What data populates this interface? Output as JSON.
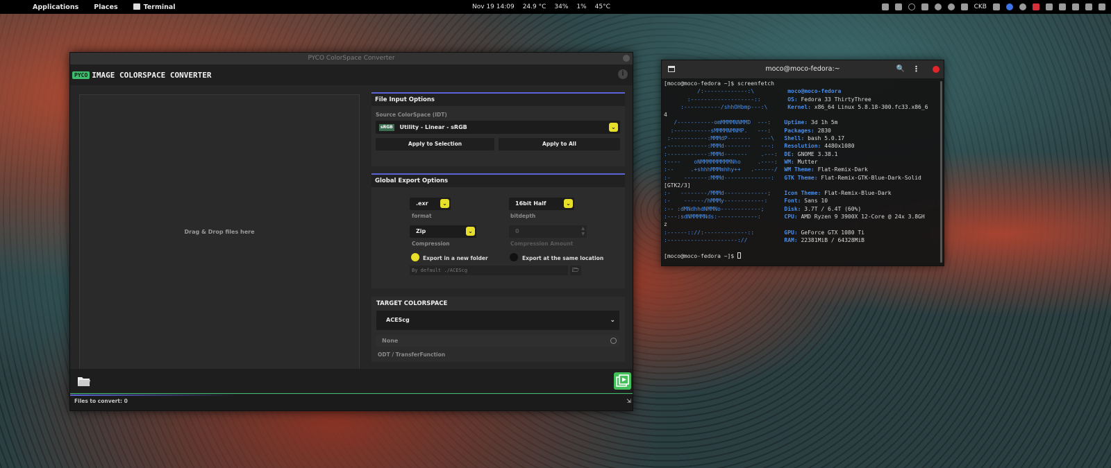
{
  "topbar": {
    "applications": "Applications",
    "places": "Places",
    "terminal": "Terminal",
    "datetime": "Nov 19  14:09",
    "stat1": "24.9 °C",
    "stat2": "34%",
    "stat3": "1%",
    "stat4": "45°C",
    "lang": "CKB"
  },
  "app": {
    "window_title": "PYCO ColorSpace Converter",
    "logo": "PYCO",
    "title": "IMAGE COLORSPACE CONVERTER",
    "info": "i",
    "dropzone_text": "Drag & Drop files here",
    "file_input": {
      "title": "File Input Options",
      "source_label": "Source ColorSpace (IDT)",
      "source_badge": "sRGB",
      "source_value": "Utility - Linear - sRGB",
      "apply_selection": "Apply to Selection",
      "apply_all": "Apply to All"
    },
    "export": {
      "title": "Global Export Options",
      "format_value": ".exr",
      "format_label": "format",
      "bitdepth_value": "16bit Half",
      "bitdepth_label": "bitdepth",
      "compression_value": "Zip",
      "compression_label": "Compression",
      "amount_value": "0",
      "amount_label": "Compression Amount",
      "radio_new_folder": "Export in a new folder",
      "radio_same_location": "Export at the same location",
      "folder_placeholder": "By default ./ACEScg"
    },
    "target": {
      "title": "TARGET COLORSPACE",
      "value": "ACEScg",
      "odt_value": "None",
      "odt_label": "ODT / TransferFunction"
    },
    "status": "Files to convert: 0"
  },
  "terminal": {
    "title": "moco@moco-fedora:~",
    "prompt1": "[moco@moco-fedora ~]$ screenfetch",
    "lines": [
      {
        "art": "          /:-------------:\\          ",
        "key": "",
        "val": "moco@moco-fedora",
        "kc": true
      },
      {
        "art": "       :-------------------::        ",
        "key": "OS: ",
        "val": "Fedora 33 ThirtyThree"
      },
      {
        "art": "     :-----------/shhOHbmp---:\\      ",
        "key": "Kernel: ",
        "val": "x86_64 Linux 5.8.18-300.fc33.x86_6"
      },
      {
        "art": "4",
        "key": "",
        "val": "",
        "plain": true
      },
      {
        "art": "   /-----------omMMMMNNMMD  ---:    ",
        "key": "Uptime: ",
        "val": "3d 1h 5m"
      },
      {
        "art": "  :-----------sMMMMNMNMP.   ---:    ",
        "key": "Packages: ",
        "val": "2830"
      },
      {
        "art": " :-----------:MMMdP-------   ---\\   ",
        "key": "Shell: ",
        "val": "bash 5.0.17"
      },
      {
        "art": ",------------:MMMd--------   ---:   ",
        "key": "Resolution: ",
        "val": "4480x1080"
      },
      {
        "art": ":------------:MMMd-------    .---:  ",
        "key": "DE: ",
        "val": "GNOME 3.38.1"
      },
      {
        "art": ":----    oNMMMMMMMMMNho     .----:  ",
        "key": "WM: ",
        "val": "Mutter"
      },
      {
        "art": ":--     .+shhhMMMmhhy++   .------/  ",
        "key": "WM Theme: ",
        "val": "Flat-Remix-Dark"
      },
      {
        "art": ":-    -------:MMMd--------------:   ",
        "key": "GTK Theme: ",
        "val": "Flat-Remix-GTK-Blue-Dark-Solid"
      },
      {
        "art": "[GTK2/3]",
        "key": "",
        "val": "",
        "plain": true
      },
      {
        "art": ":-   --------/MMMd-------------;    ",
        "key": "Icon Theme: ",
        "val": "Flat-Remix-Blue-Dark"
      },
      {
        "art": ":-    ------/hMMMy------------:     ",
        "key": "Font: ",
        "val": "Sans 10"
      },
      {
        "art": ":-- :dMNdhhdNMMNo------------;      ",
        "key": "Disk: ",
        "val": "3.7T / 6.4T (60%)"
      },
      {
        "art": ":---:sdNMMMMNds:------------:       ",
        "key": "CPU: ",
        "val": "AMD Ryzen 9 3900X 12-Core @ 24x 3.8GH"
      },
      {
        "art": "z",
        "key": "",
        "val": "",
        "plain": true
      },
      {
        "art": ":------:://:-------------::         ",
        "key": "GPU: ",
        "val": "GeForce GTX 1080 Ti"
      },
      {
        "art": ":---------------------://           ",
        "key": "RAM: ",
        "val": "22381MiB / 64328MiB"
      },
      {
        "art": "",
        "key": "",
        "val": "",
        "plain": true
      }
    ],
    "prompt2": "[moco@moco-fedora ~]$ "
  }
}
